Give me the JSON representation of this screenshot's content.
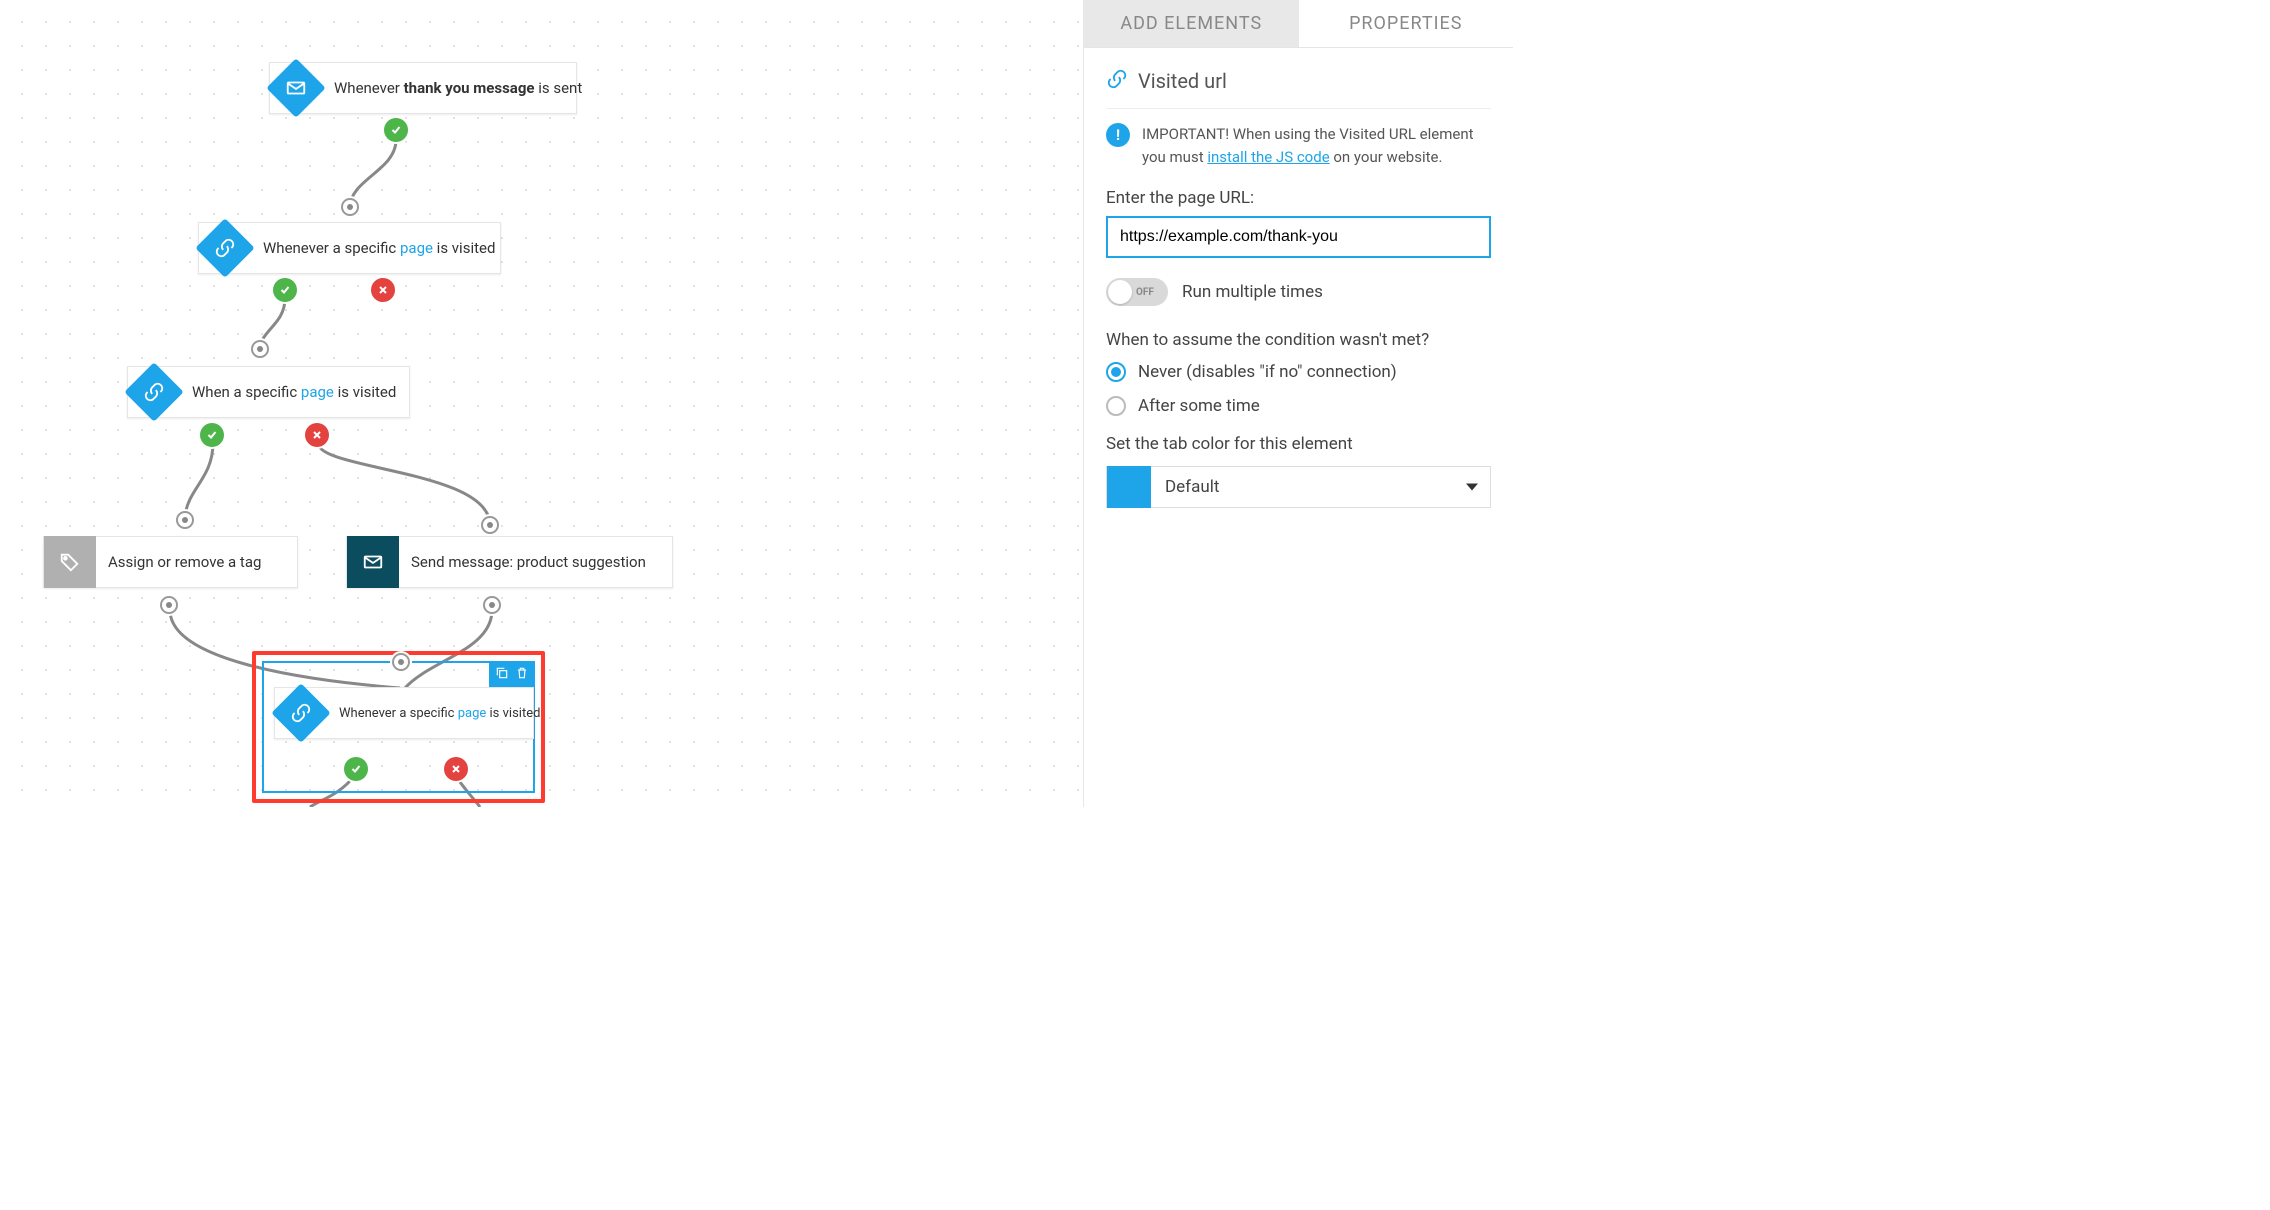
{
  "sidebar": {
    "tabs": {
      "add_elements": "ADD ELEMENTS",
      "properties": "PROPERTIES"
    },
    "panel_title": "Visited url",
    "info_prefix": "IMPORTANT! When using the Visited URL element you must ",
    "info_link": "install the JS code",
    "info_suffix": " on your website.",
    "url_label": "Enter the page URL:",
    "url_value": "https://example.com/thank-you",
    "toggle_off": "OFF",
    "toggle_label": "Run multiple times",
    "condition_question": "When to assume the condition wasn't met?",
    "radio_never": "Never (disables \"if no\" connection)",
    "radio_after": "After some time",
    "color_label": "Set the tab color for this element",
    "color_value": "Default"
  },
  "nodes": {
    "n1_prefix": "Whenever ",
    "n1_bold": "thank you message",
    "n1_suffix": " is sent",
    "n2_prefix": "Whenever a specific ",
    "n2_link": "page",
    "n2_suffix": " is visited",
    "n3_prefix": "When a specific ",
    "n3_link": "page",
    "n3_suffix": " is visited",
    "n4_text": "Assign or remove a tag",
    "n5_text": "Send message: product suggestion",
    "n6_prefix": "Whenever a specific ",
    "n6_link": "page",
    "n6_suffix": " is visited"
  }
}
